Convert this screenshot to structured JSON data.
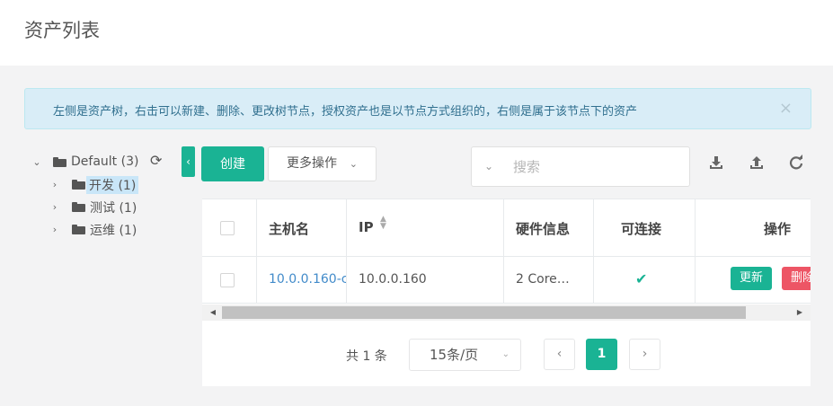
{
  "page": {
    "title": "资产列表"
  },
  "alert": {
    "text": "左侧是资产树，右击可以新建、删除、更改树节点，授权资产也是以节点方式组织的，右侧是属于该节点下的资产",
    "close_glyph": "×"
  },
  "tree": {
    "root": {
      "toggle": "⌄",
      "label": "Default (3)",
      "refresh_glyph": "⟳"
    },
    "children": [
      {
        "toggle": "›",
        "label": "开发 (1)",
        "selected": true
      },
      {
        "toggle": "›",
        "label": "测试 (1)",
        "selected": false
      },
      {
        "toggle": "›",
        "label": "运维 (1)",
        "selected": false
      }
    ]
  },
  "toolbar": {
    "collapse_glyph": "‹",
    "create_label": "创建",
    "more_label": "更多操作",
    "more_caret": "⌄",
    "search_chevron": "⌄",
    "search_placeholder": "搜索",
    "icons": [
      "download-icon",
      "upload-icon",
      "refresh-icon"
    ]
  },
  "table": {
    "columns": [
      "",
      "主机名",
      "IP",
      "硬件信息",
      "可连接",
      "操作"
    ],
    "rows": [
      {
        "hostname": "10.0.0.160-c",
        "ip": "10.0.0.160",
        "hardware": "2 Core…",
        "connectable_glyph": "✔",
        "update_label": "更新",
        "delete_label": "删除"
      }
    ]
  },
  "scrollbar": {
    "left_arrow": "◀",
    "right_arrow": "▶"
  },
  "pagination": {
    "total_text": "共 1 条",
    "page_size": "15条/页",
    "page_size_caret": "⌄",
    "prev_glyph": "‹",
    "current_page": "1",
    "next_glyph": "›"
  },
  "colors": {
    "primary": "#1ab394",
    "danger": "#ed5565",
    "link": "#428bca",
    "info_bg": "#d9edf7"
  }
}
